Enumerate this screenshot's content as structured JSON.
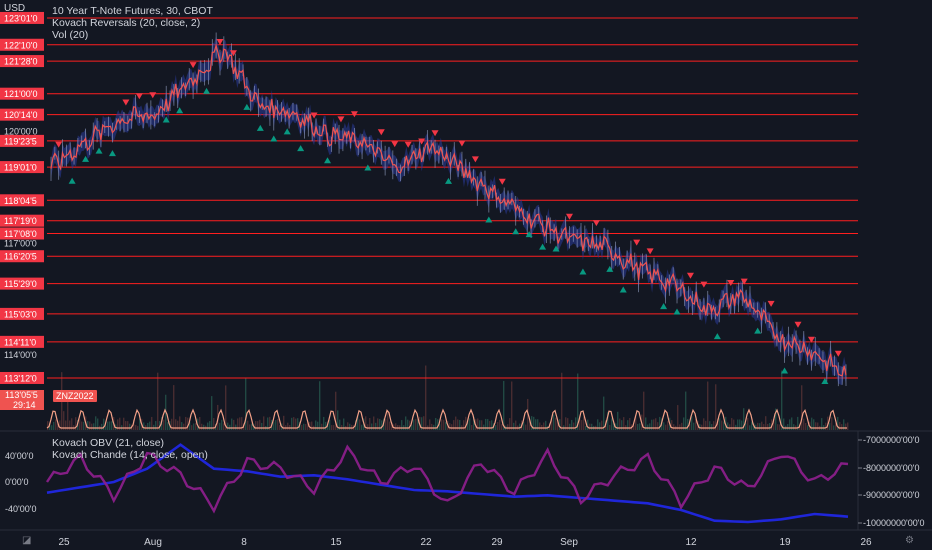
{
  "chart_data": [
    {
      "type": "line",
      "title": "10 Year T-Note Futures, 30, CBOT",
      "currency": "USD",
      "indicators": [
        "Kovach Reversals (20, close, 2)",
        "Vol (20)"
      ],
      "x_ticks": [
        "25",
        "Aug",
        "8",
        "15",
        "22",
        "29",
        "Sep",
        "12",
        "19",
        "26"
      ],
      "y_ticks": [
        "123'01'0",
        "122'10'0",
        "121'28'0",
        "121'00'0",
        "120'14'0",
        "120'00'0",
        "119'23'5",
        "119'01'0",
        "118'04'5",
        "117'19'0",
        "117'08'0",
        "117'00'0",
        "116'20'5",
        "115'29'0",
        "115'03'0",
        "114'11'0",
        "114'00'0",
        "113'12'0"
      ],
      "red_levels": [
        "123'01'0",
        "122'10'0",
        "121'28'0",
        "121'00'0",
        "120'14'0",
        "119'23'5",
        "119'01'0",
        "118'04'5",
        "117'19'0",
        "117'08'0",
        "116'20'5",
        "115'29'0",
        "115'03'0",
        "114'11'0",
        "113'12'0"
      ],
      "price_series": {
        "x_range": [
          "Jul 22",
          "Sep 23"
        ],
        "close_approx": [
          119.03,
          119.7,
          120.3,
          120.45,
          121.3,
          122.2,
          120.7,
          120.5,
          119.9,
          119.7,
          119.0,
          119.6,
          118.9,
          118.2,
          117.6,
          117.1,
          116.9,
          116.3,
          115.9,
          115.2,
          115.6,
          114.5,
          114.1,
          113.45
        ],
        "color": "#ef5350"
      },
      "current_price": {
        "label": "113'05'5",
        "countdown": "29:14",
        "symbol": "ZNZ2022",
        "color": "#ef5350"
      },
      "markers": {
        "down": "#f23645",
        "up": "#089981"
      },
      "grid": false
    },
    {
      "type": "line",
      "indicators": [
        "Kovach OBV (21, close)",
        "Kovach Chande (14, close, open)"
      ],
      "left_ticks": [
        "40'00'0",
        "0'00'0",
        "-40'00'0"
      ],
      "right_ticks": [
        "-7000000'00'0",
        "-8000000'00'0",
        "-9000000'00'0",
        "-10000000'00'0"
      ],
      "series": [
        {
          "name": "Kovach OBV (21, close)",
          "color": "#1f26d9",
          "values": [
            -8.9,
            -8.7,
            -8.5,
            -8.0,
            -7.1,
            -8.0,
            -8.1,
            -8.3,
            -8.25,
            -8.4,
            -8.6,
            -8.8,
            -8.85,
            -8.95,
            -9.05,
            -9.0,
            -9.1,
            -9.2,
            -9.3,
            -9.55,
            -9.95,
            -10.0,
            -9.9,
            -9.7,
            -9.8
          ]
        },
        {
          "name": "Kovach Chande (14, close, open)",
          "color": "#8a1f8a",
          "values": [
            0,
            35,
            -20,
            40,
            10,
            -35,
            30,
            20,
            -10,
            45,
            0,
            25,
            -35,
            30,
            -15,
            40,
            -25,
            10,
            35,
            -30,
            20,
            -10,
            45,
            0,
            25
          ]
        }
      ]
    }
  ],
  "corner_icon": "tradingview-logo-icon",
  "settings_icon": "gear-icon"
}
